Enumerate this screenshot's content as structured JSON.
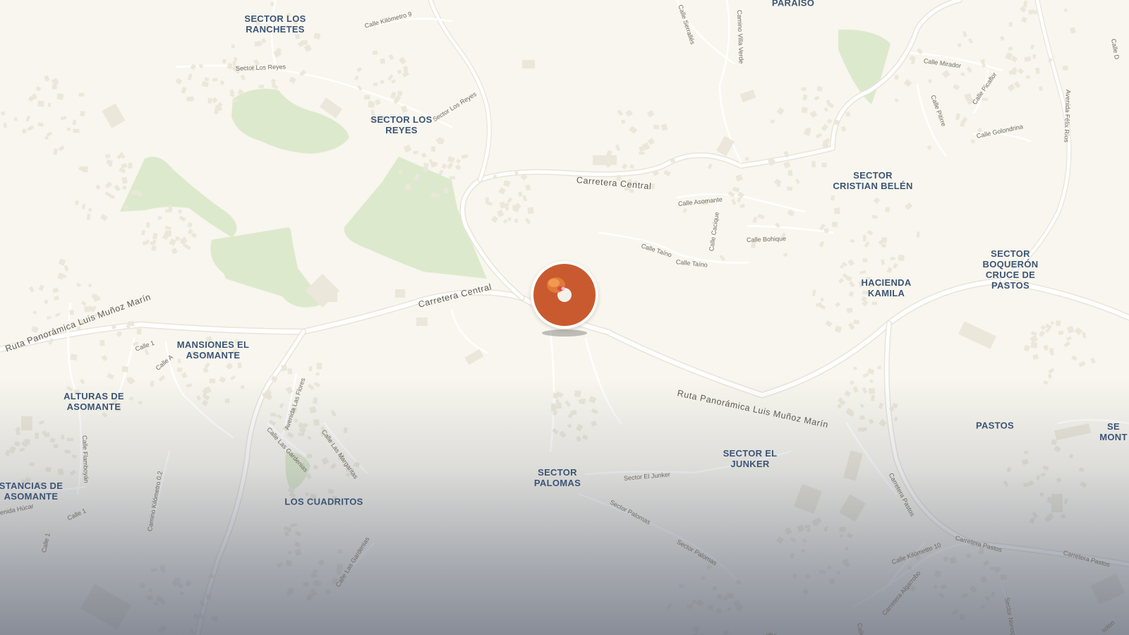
{
  "places": [
    {
      "id": "sector-los-ranchetes",
      "label": "SECTOR LOS\nRANCHETES"
    },
    {
      "id": "paraiso",
      "label": "PARAÍSO"
    },
    {
      "id": "sector-los-reyes",
      "label": "SECTOR LOS\nREYES"
    },
    {
      "id": "sector-cristian-belen",
      "label": "SECTOR\nCRISTIAN BELÉN"
    },
    {
      "id": "sector-boqueron",
      "label": "SECTOR\nBOQUERÓN\nCRUCE DE\nPASTOS"
    },
    {
      "id": "hacienda-kamila",
      "label": "HACIENDA\nKAMILA"
    },
    {
      "id": "mansiones-el-asomante",
      "label": "MANSIONES EL\nASOMANTE"
    },
    {
      "id": "alturas-de-asomante",
      "label": "ALTURAS DE\nASOMANTE"
    },
    {
      "id": "estancias-de-asomante",
      "label": "STANCIAS DE\nASOMANTE"
    },
    {
      "id": "los-cuadritos",
      "label": "LOS CUADRITOS"
    },
    {
      "id": "sector-palomas",
      "label": "SECTOR\nPALOMAS"
    },
    {
      "id": "sector-el-junker",
      "label": "SECTOR EL\nJUNKER"
    },
    {
      "id": "pastos",
      "label": "PASTOS"
    },
    {
      "id": "sector-mont",
      "label": "SE\nMONT"
    }
  ],
  "roads": [
    {
      "id": "carretera-central-1",
      "label": "Carretera Central",
      "major": true
    },
    {
      "id": "carretera-central-2",
      "label": "Carretera Central",
      "major": true
    },
    {
      "id": "ruta-panoramica-1",
      "label": "Ruta Panorámica Luis Muñoz Marín",
      "major": true
    },
    {
      "id": "ruta-panoramica-2",
      "label": "Ruta Panorámica Luis Muñoz Marín",
      "major": true
    },
    {
      "id": "calle-kilometro-9",
      "label": "Calle Kilómetro 9"
    },
    {
      "id": "sector-los-reyes-road-1",
      "label": "Sector Los Reyes"
    },
    {
      "id": "sector-los-reyes-road-2",
      "label": "Sector Los Reyes"
    },
    {
      "id": "calle-serralles",
      "label": "Calle Serrallés"
    },
    {
      "id": "camino-villa-verde",
      "label": "Camino Villa Verde"
    },
    {
      "id": "calle-mirador",
      "label": "Calle Mirador"
    },
    {
      "id": "calle-picaflor",
      "label": "Calle Picaflor"
    },
    {
      "id": "calle-pitirre",
      "label": "Calle Pitirre"
    },
    {
      "id": "calle-golondrina",
      "label": "Calle Golondrina"
    },
    {
      "id": "avenida-felix-rios",
      "label": "Avenida Félix Ríos"
    },
    {
      "id": "calle-asomante",
      "label": "Calle Asomante"
    },
    {
      "id": "calle-cacique",
      "label": "Calle Cacique"
    },
    {
      "id": "calle-bohique",
      "label": "Calle Bohique"
    },
    {
      "id": "calle-taino-1",
      "label": "Calle Taíno"
    },
    {
      "id": "calle-taino-2",
      "label": "Calle Taíno"
    },
    {
      "id": "calle-1-a",
      "label": "Calle 1"
    },
    {
      "id": "calle-a",
      "label": "Calle A"
    },
    {
      "id": "avenida-las-flores",
      "label": "Avenida Las Flores"
    },
    {
      "id": "calle-las-gardenias-1",
      "label": "Calle Las Gardenias"
    },
    {
      "id": "calle-las-margaritas",
      "label": "Calle Las Margaritas"
    },
    {
      "id": "calle-flamboyan",
      "label": "Calle Flamboyán"
    },
    {
      "id": "camino-kilometro-0-2",
      "label": "Camino Kilómetro 0.2"
    },
    {
      "id": "calle-las-gardenias-2",
      "label": "Calle Las Gardenias"
    },
    {
      "id": "calle-1-b",
      "label": "Calle 1"
    },
    {
      "id": "calle-1-c",
      "label": "Calle 1"
    },
    {
      "id": "calle-hucar",
      "label": "enida Húcar"
    },
    {
      "id": "sector-el-junker-road",
      "label": "Sector El Junker"
    },
    {
      "id": "sector-palomas-road-1",
      "label": "Sector Palomas"
    },
    {
      "id": "sector-palomas-road-2",
      "label": "Sector Palomas"
    },
    {
      "id": "carretera-pastos-1",
      "label": "Carretera Pastos"
    },
    {
      "id": "carretera-pastos-2",
      "label": "Carretera Pastos"
    },
    {
      "id": "carretera-pastos-3",
      "label": "Carretera Pastos"
    },
    {
      "id": "calle-kilometro-10",
      "label": "Calle Kilómetro 10"
    },
    {
      "id": "carretera-algarrobo",
      "label": "Carretera Algarrobo"
    },
    {
      "id": "sector-nonogu",
      "label": "Sector Nonogu"
    },
    {
      "id": "calle-colon",
      "label": "Calle Colón"
    },
    {
      "id": "solon",
      "label": "solon"
    },
    {
      "id": "obo",
      "label": "obo"
    },
    {
      "id": "calle-d",
      "label": "Calle D"
    }
  ],
  "marker": {
    "icon": "fire-hydrant-icon",
    "color": "#c95a2f"
  },
  "colors": {
    "land": "#f8f6ee",
    "park": "#dde9cc",
    "road": "#ffffff",
    "label": "#3c5575"
  }
}
